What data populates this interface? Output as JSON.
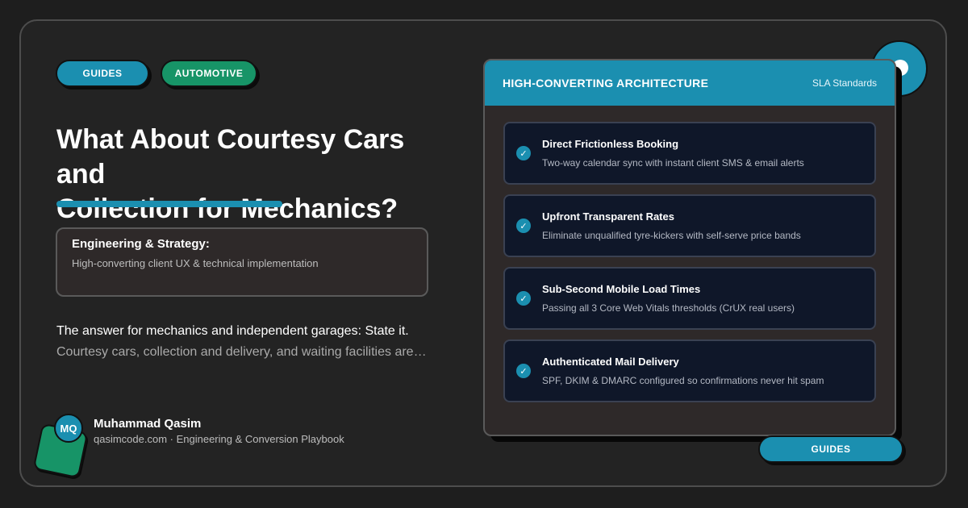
{
  "tags": [
    "GUIDES",
    "AUTOMOTIVE"
  ],
  "title_line1": "What About Courtesy Cars and",
  "title_line2": "Collection for Mechanics?",
  "strategy": {
    "title": "Engineering & Strategy:",
    "description": "High-converting client UX & technical implementation"
  },
  "answer": {
    "line1": "The answer for mechanics and independent garages: State it.",
    "line2": "Courtesy cars, collection and delivery, and waiting facilities are…"
  },
  "author": {
    "initials": "MQ",
    "name": "Muhammad Qasim",
    "subtitle": "qasimcode.com · Engineering & Conversion Playbook"
  },
  "card": {
    "title": "HIGH-CONVERTING ARCHITECTURE",
    "subtitle": "SLA Standards",
    "items": [
      {
        "title": "Direct Frictionless Booking",
        "description": "Two-way calendar sync with instant client SMS & email alerts"
      },
      {
        "title": "Upfront Transparent Rates",
        "description": "Eliminate unqualified tyre-kickers with self-serve price bands"
      },
      {
        "title": "Sub-Second Mobile Load Times",
        "description": "Passing all 3 Core Web Vitals thresholds (CrUX real users)"
      },
      {
        "title": "Authenticated Mail Delivery",
        "description": "SPF, DKIM & DMARC configured so confirmations never hit spam"
      }
    ]
  },
  "bottom_tag": "GUIDES",
  "icons": {
    "check": "check-circle-icon"
  },
  "colors": {
    "accent_blue": "#1b8fb0",
    "accent_green": "#179467",
    "background": "#1e1e1e",
    "item_background": "#0f1729"
  }
}
